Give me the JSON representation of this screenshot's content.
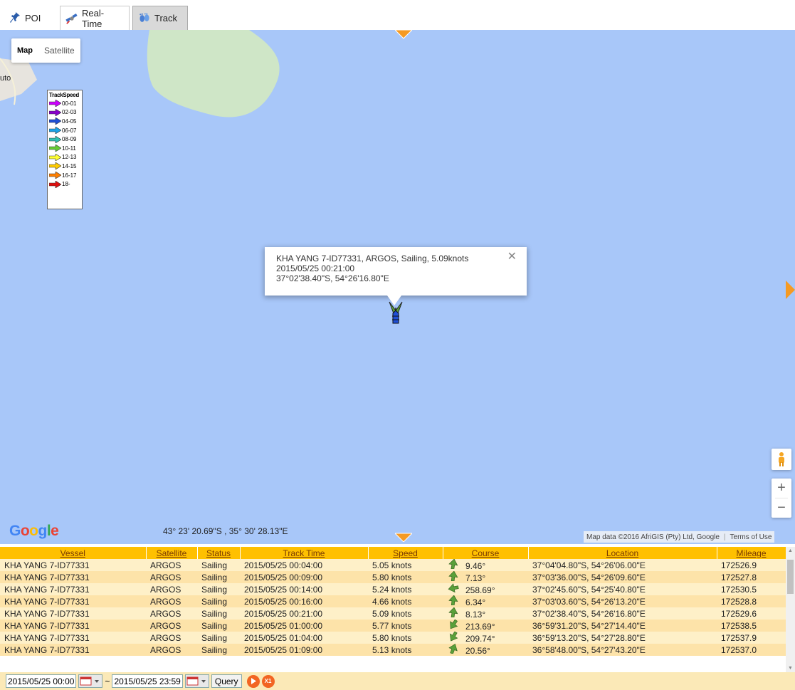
{
  "tabs": [
    {
      "label": "POI",
      "icon": "pushpin-icon"
    },
    {
      "label": "Real-Time",
      "icon": "satellite-icon"
    },
    {
      "label": "Track",
      "icon": "footprints-icon"
    }
  ],
  "map": {
    "maptype": {
      "map": "Map",
      "satellite": "Satellite"
    },
    "town_label": "uto",
    "legend": {
      "title": "TrackSpeed",
      "items": [
        {
          "label": "00-01",
          "color": "#cc00ff"
        },
        {
          "label": "02-03",
          "color": "#8800cc"
        },
        {
          "label": "04-05",
          "color": "#1f4fd6"
        },
        {
          "label": "06-07",
          "color": "#1aa3e8"
        },
        {
          "label": "08-09",
          "color": "#2ec1b3"
        },
        {
          "label": "10-11",
          "color": "#66cc33"
        },
        {
          "label": "12-13",
          "color": "#ffff33"
        },
        {
          "label": "14-15",
          "color": "#ffcc00"
        },
        {
          "label": "16-17",
          "color": "#ff7f00"
        },
        {
          "label": "18-",
          "color": "#e01010"
        }
      ]
    },
    "info_window": {
      "line1": "KHA YANG 7-ID77331, ARGOS, Sailing, 5.09knots",
      "line2": "2015/05/25 00:21:00",
      "line3": "37°02'38.40\"S, 54°26'16.80\"E"
    },
    "google": "Google",
    "cursor_coords": "43° 23' 20.69\"S , 35° 30' 28.13\"E",
    "map_data": "Map data ©2016 AfriGIS (Pty) Ltd, Google",
    "terms": "Terms of Use",
    "zoom_in": "+",
    "zoom_out": "−"
  },
  "table": {
    "headers": [
      "Vessel",
      "Satellite",
      "Status",
      "Track Time",
      "Speed",
      "Course",
      "Location",
      "Mileage"
    ],
    "rows": [
      {
        "vessel": "KHA YANG 7-ID77331",
        "satellite": "ARGOS",
        "status": "Sailing",
        "time": "2015/05/25 00:04:00",
        "speed": "5.05 knots",
        "course": "9.46°",
        "location": "37°04'04.80\"S, 54°26'06.00\"E",
        "mileage": "172526.9"
      },
      {
        "vessel": "KHA YANG 7-ID77331",
        "satellite": "ARGOS",
        "status": "Sailing",
        "time": "2015/05/25 00:09:00",
        "speed": "5.80 knots",
        "course": "7.13°",
        "location": "37°03'36.00\"S, 54°26'09.60\"E",
        "mileage": "172527.8"
      },
      {
        "vessel": "KHA YANG 7-ID77331",
        "satellite": "ARGOS",
        "status": "Sailing",
        "time": "2015/05/25 00:14:00",
        "speed": "5.24 knots",
        "course": "258.69°",
        "location": "37°02'45.60\"S, 54°25'40.80\"E",
        "mileage": "172530.5"
      },
      {
        "vessel": "KHA YANG 7-ID77331",
        "satellite": "ARGOS",
        "status": "Sailing",
        "time": "2015/05/25 00:16:00",
        "speed": "4.66 knots",
        "course": "6.34°",
        "location": "37°03'03.60\"S, 54°26'13.20\"E",
        "mileage": "172528.8"
      },
      {
        "vessel": "KHA YANG 7-ID77331",
        "satellite": "ARGOS",
        "status": "Sailing",
        "time": "2015/05/25 00:21:00",
        "speed": "5.09 knots",
        "course": "8.13°",
        "location": "37°02'38.40\"S, 54°26'16.80\"E",
        "mileage": "172529.6"
      },
      {
        "vessel": "KHA YANG 7-ID77331",
        "satellite": "ARGOS",
        "status": "Sailing",
        "time": "2015/05/25 01:00:00",
        "speed": "5.77 knots",
        "course": "213.69°",
        "location": "36°59'31.20\"S, 54°27'14.40\"E",
        "mileage": "172538.5"
      },
      {
        "vessel": "KHA YANG 7-ID77331",
        "satellite": "ARGOS",
        "status": "Sailing",
        "time": "2015/05/25 01:04:00",
        "speed": "5.80 knots",
        "course": "209.74°",
        "location": "36°59'13.20\"S, 54°27'28.80\"E",
        "mileage": "172537.9"
      },
      {
        "vessel": "KHA YANG 7-ID77331",
        "satellite": "ARGOS",
        "status": "Sailing",
        "time": "2015/05/25 01:09:00",
        "speed": "5.13 knots",
        "course": "20.56°",
        "location": "36°58'48.00\"S, 54°27'43.20\"E",
        "mileage": "172537.0"
      }
    ]
  },
  "bottom": {
    "start": "2015/05/25 00:00",
    "tilde": "~",
    "end": "2015/05/25 23:59",
    "query": "Query",
    "speed_badge": "X1"
  }
}
